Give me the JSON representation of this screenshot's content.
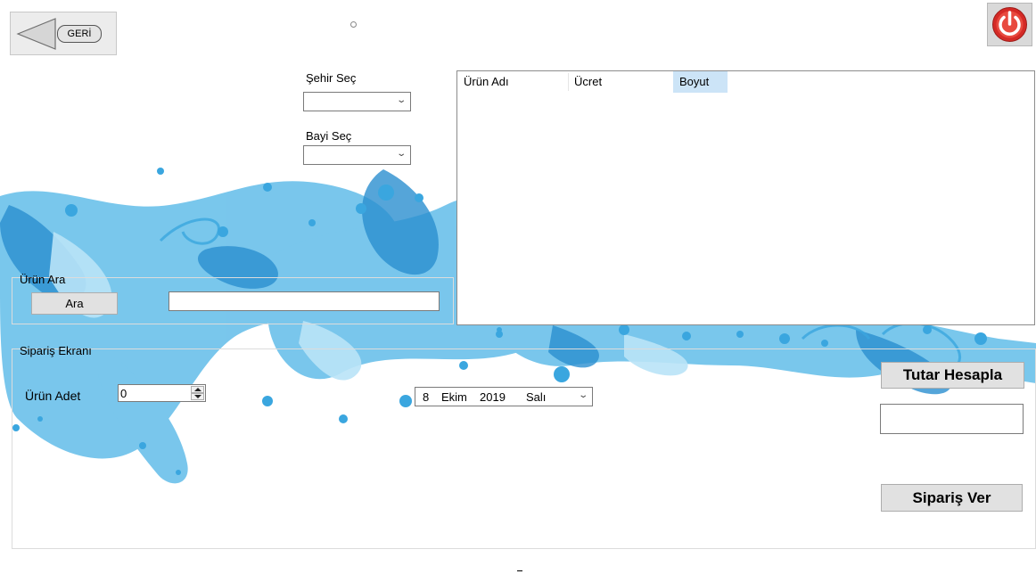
{
  "header": {
    "back_label": "GERİ"
  },
  "filters": {
    "city_label": "Şehir Seç",
    "city_value": "",
    "dealer_label": "Bayi Seç",
    "dealer_value": ""
  },
  "product_list": {
    "columns": [
      "Ürün Adı",
      "Ücret",
      "Boyut"
    ],
    "rows": []
  },
  "search_group": {
    "title": "Ürün Ara",
    "button_label": "Ara",
    "input_value": ""
  },
  "order_group": {
    "title": "Sipariş Ekranı",
    "quantity_label": "Ürün Adet",
    "quantity_value": "0",
    "date": {
      "day": "8",
      "month": "Ekim",
      "year": "2019",
      "weekday": "Salı"
    },
    "calculate_label": "Tutar Hesapla",
    "total_value": "",
    "order_label": "Sipariş Ver"
  },
  "colors": {
    "selected_header": "#cce4f7",
    "power_red": "#d42a26",
    "splash_blue": "#3aa6df"
  },
  "icons": [
    "back-arrow-icon",
    "power-icon",
    "chevron-down-icon"
  ]
}
